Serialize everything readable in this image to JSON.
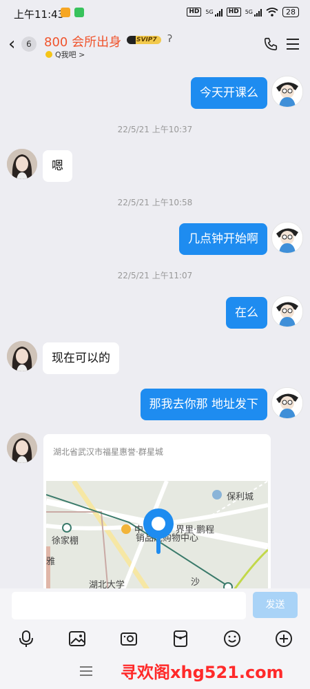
{
  "status": {
    "time": "上午11:43",
    "battery": "28",
    "net1": "HD",
    "net2": "HD",
    "gen1": "5G",
    "gen2": "5G"
  },
  "header": {
    "back_count": "6",
    "title": "800 会所出身",
    "vip": "SVIP7",
    "subtitle": "Q我吧 >"
  },
  "messages": [
    {
      "side": "me",
      "text": "今天开课么"
    },
    {
      "type": "timestamp",
      "text": "22/5/21 上午10:37"
    },
    {
      "side": "them",
      "text": "嗯"
    },
    {
      "type": "timestamp",
      "text": "22/5/21 上午10:58"
    },
    {
      "side": "me",
      "text": "几点钟开始啊"
    },
    {
      "type": "timestamp",
      "text": "22/5/21 上午11:07"
    },
    {
      "side": "me",
      "text": "在么"
    },
    {
      "side": "them",
      "text": "现在可以的"
    },
    {
      "side": "me",
      "text": "那我去你那 地址发下"
    }
  ],
  "location": {
    "address": "湖北省武汉市福星惠誉·群星城",
    "map_labels": [
      "保利城",
      "徐家棚",
      "中",
      "界里·鹏程",
      "销品茂购物中心",
      "湖北大学",
      "沙",
      "雅"
    ]
  },
  "input": {
    "placeholder": "",
    "send_label": "发送"
  },
  "toolbar_icons": [
    "microphone-icon",
    "image-icon",
    "camera-icon",
    "red-packet-icon",
    "emoji-icon",
    "plus-icon"
  ],
  "watermark": "寻欢阁xhg521.com"
}
